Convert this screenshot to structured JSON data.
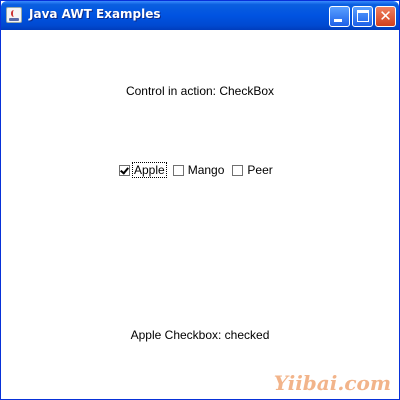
{
  "window": {
    "title": "Java AWT Examples",
    "icon": "java-cup-icon",
    "controls": [
      "minimize",
      "maximize",
      "close"
    ],
    "close_glyph": "✕"
  },
  "main": {
    "heading": "Control in action: CheckBox",
    "checkboxes": [
      {
        "label": "Apple",
        "checked": true,
        "focused": true
      },
      {
        "label": "Mango",
        "checked": false
      },
      {
        "label": "Peer",
        "checked": false
      }
    ],
    "status": "Apple Checkbox: checked"
  },
  "watermark": "Yiibai.com",
  "colors": {
    "titlebar": "#0053e1",
    "close_button": "#d1401e",
    "watermark": "#f2b48a"
  }
}
